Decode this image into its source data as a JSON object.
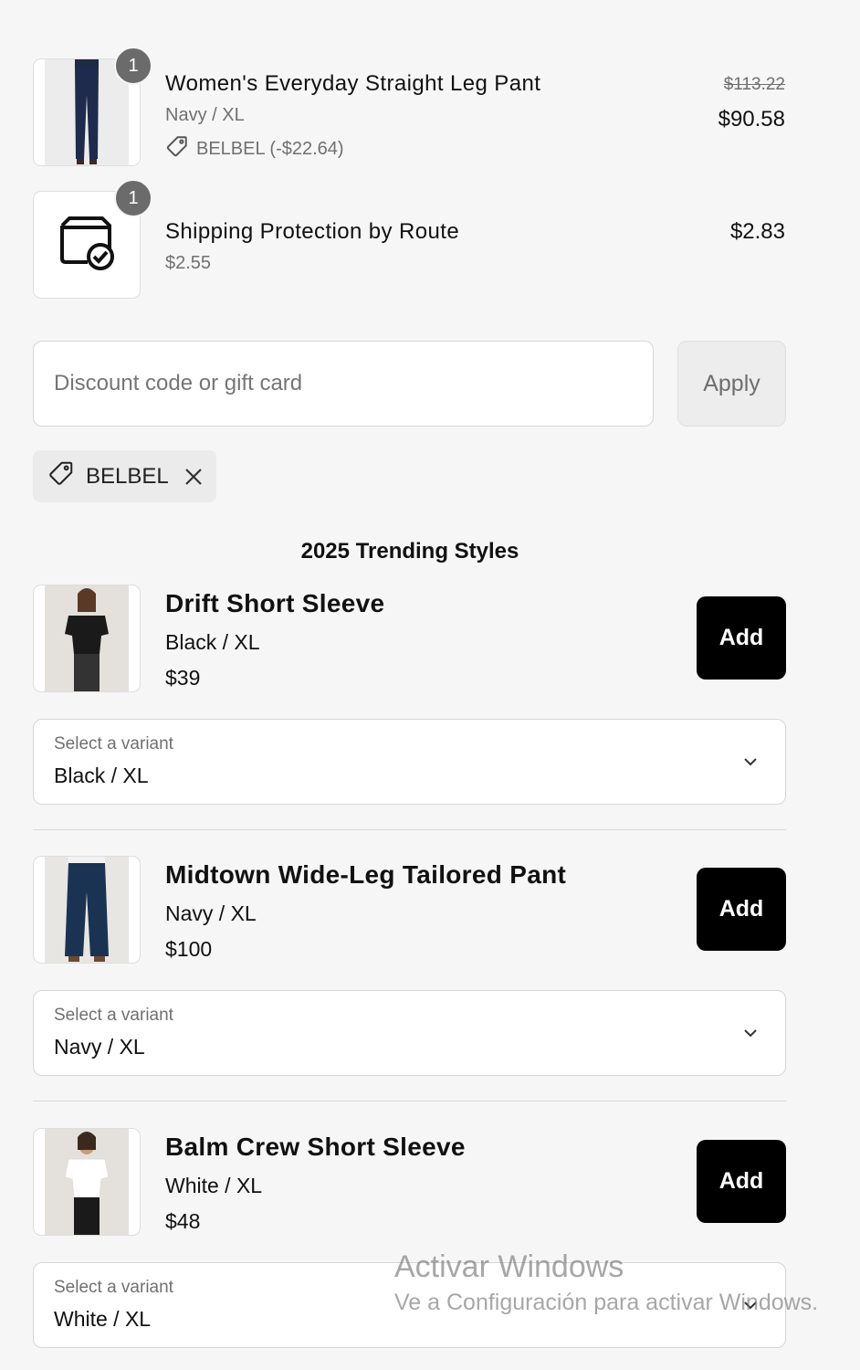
{
  "cart": {
    "items": [
      {
        "quantity": "1",
        "title": "Women's Everyday Straight Leg Pant",
        "variant": "Navy / XL",
        "discount": "BELBEL (-$22.64)",
        "original_price": "$113.22",
        "price": "$90.58"
      },
      {
        "quantity": "1",
        "title": "Shipping Protection by Route",
        "variant": "$2.55",
        "price": "$2.83"
      }
    ]
  },
  "discount": {
    "placeholder": "Discount code or gift card",
    "apply_label": "Apply",
    "applied_code": "BELBEL"
  },
  "trending": {
    "title": "2025 Trending Styles",
    "products": [
      {
        "name": "Drift Short Sleeve",
        "variant": "Black / XL",
        "price": "$39",
        "add_label": "Add",
        "select_label": "Select a variant",
        "selected_variant": "Black / XL"
      },
      {
        "name": "Midtown Wide-Leg Tailored Pant",
        "variant": "Navy / XL",
        "price": "$100",
        "add_label": "Add",
        "select_label": "Select a variant",
        "selected_variant": "Navy / XL"
      },
      {
        "name": "Balm Crew Short Sleeve",
        "variant": "White / XL",
        "price": "$48",
        "add_label": "Add",
        "select_label": "Select a variant",
        "selected_variant": "White / XL"
      }
    ]
  },
  "watermark": {
    "title": "Activar Windows",
    "subtitle": "Ve a Configuración para activar Windows."
  },
  "icons": {
    "tag": "tag-icon",
    "close": "close-icon",
    "chevron": "chevron-down-icon",
    "shipping": "package-check-icon"
  },
  "colors": {
    "background": "#f6f6f6",
    "add_button": "#000000",
    "badge": "#6b6b6b"
  }
}
